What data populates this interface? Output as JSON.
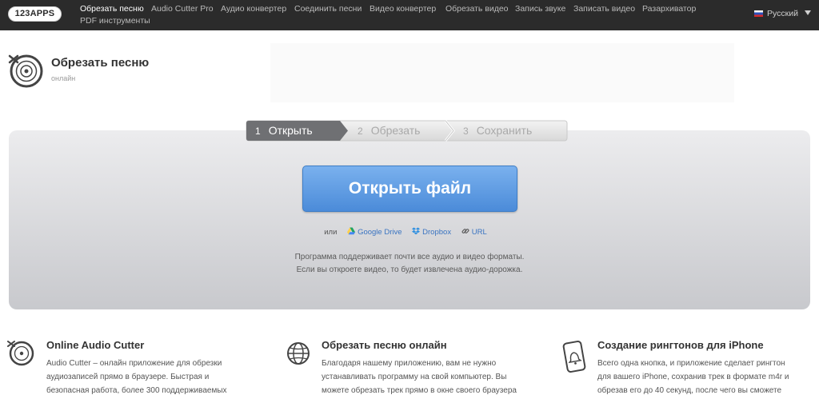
{
  "brand": {
    "logo_text": "123APPS"
  },
  "nav": {
    "items": [
      {
        "label": "Обрезать песню",
        "active": true
      },
      {
        "label": "Audio Cutter Pro"
      },
      {
        "label": "Аудио конвертер"
      },
      {
        "label": "Соединить песни"
      },
      {
        "label": "Видео конвертер"
      },
      {
        "label": "Обрезать видео"
      },
      {
        "label": "Запись звуке"
      },
      {
        "label": "Записать видео"
      },
      {
        "label": "Разархиватор"
      },
      {
        "label": "PDF инструменты"
      }
    ],
    "language": "Русский"
  },
  "app": {
    "title": "Обрезать песню",
    "subtitle": "онлайн"
  },
  "steps": [
    {
      "number": "1",
      "label": "Открыть",
      "active": true
    },
    {
      "number": "2",
      "label": "Обрезать"
    },
    {
      "number": "3",
      "label": "Сохранить"
    }
  ],
  "main": {
    "open_button": "Открыть файл",
    "or_label": "или",
    "sources": [
      {
        "label": "Google Drive",
        "icon": "google-drive-icon"
      },
      {
        "label": "Dropbox",
        "icon": "dropbox-icon"
      },
      {
        "label": "URL",
        "icon": "link-icon"
      }
    ],
    "formats_line1": "Программа поддерживает почти все аудио и видео форматы.",
    "formats_line2": "Если вы откроете видео, то будет извлечена  аудио-дорожка."
  },
  "features": [
    {
      "title": "Online Audio Cutter",
      "icon": "vinyl-scissors-icon",
      "lines": [
        "Audio Cutter – онлайн приложение для обрезки",
        "аудиозаписей прямо в браузере. Быстрая и",
        "безопасная работа, более 300 поддерживаемых"
      ]
    },
    {
      "title": "Обрезать песню онлайн",
      "icon": "globe-icon",
      "lines": [
        "Благодаря нашему приложению, вам не нужно",
        "устанавливать программу на свой компьютер. Вы",
        "можете обрезать трек прямо в окне своего браузера"
      ]
    },
    {
      "title": "Создание рингтонов для iPhone",
      "icon": "phone-bell-icon",
      "lines": [
        "Всего одна кнопка, и приложение сделает рингтон",
        "для вашего iPhone, сохранив трек в формате m4r и",
        "обрезав его до 40 секунд, после чего вы сможете"
      ]
    }
  ],
  "colors": {
    "topbar": "#2b2b2b",
    "accent_blue": "#4b8bd9",
    "link_blue": "#3a74c1",
    "step_active": "#6f7073"
  }
}
